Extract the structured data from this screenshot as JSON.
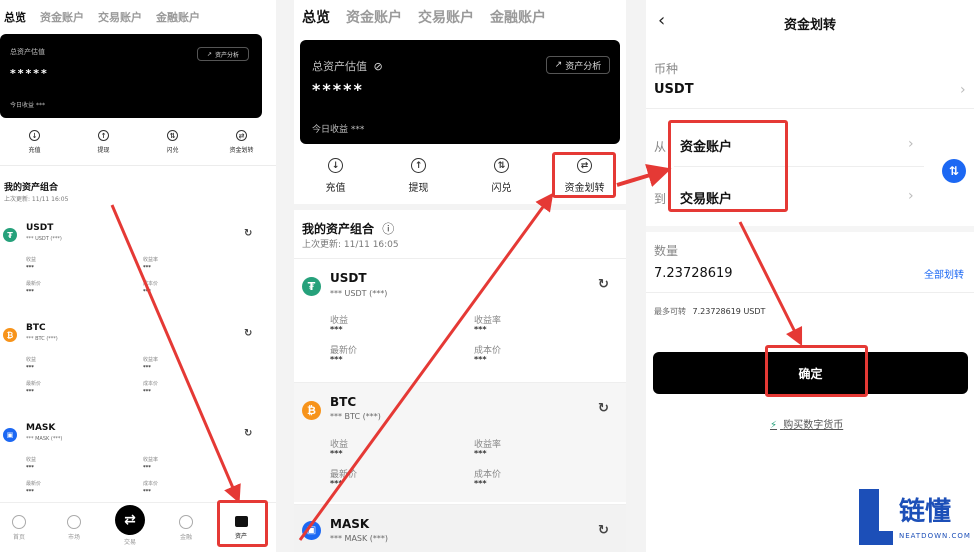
{
  "panel1": {
    "tabs": [
      "总览",
      "资金账户",
      "交易账户",
      "金融账户"
    ],
    "card": {
      "label": "总资产估值",
      "value": "*****",
      "analysis": "资产分析",
      "today": "今日收益",
      "today_value": "***"
    },
    "actions": [
      "充值",
      "提现",
      "闪兑",
      "资金划转"
    ],
    "section_title": "我的资产组合",
    "updated": "上次更新: 11/11 16:05",
    "assets": [
      {
        "symbol": "USDT",
        "sub": "*** USDT (***)",
        "f1": "收益",
        "f2": "收益率",
        "f3": "最新价",
        "f4": "成本价",
        "v": "***"
      },
      {
        "symbol": "BTC",
        "sub": "*** BTC (***)",
        "f1": "收益",
        "f2": "收益率",
        "f3": "最新价",
        "f4": "成本价",
        "v": "***"
      },
      {
        "symbol": "MASK",
        "sub": "*** MASK (***)",
        "f1": "收益",
        "f2": "收益率",
        "f3": "最新价",
        "f4": "成本价",
        "v": "***"
      }
    ],
    "nav": [
      "首页",
      "市场",
      "交易",
      "金融",
      "资产"
    ]
  },
  "panel2": {
    "tabs": [
      "总览",
      "资金账户",
      "交易账户",
      "金融账户"
    ],
    "card": {
      "label": "总资产估值",
      "value": "*****",
      "analysis": "资产分析",
      "today": "今日收益",
      "today_value": "***"
    },
    "actions": [
      "充值",
      "提现",
      "闪兑",
      "资金划转"
    ],
    "section_title": "我的资产组合",
    "updated": "上次更新: 11/11 16:05",
    "assets": [
      {
        "symbol": "USDT",
        "sub": "*** USDT (***)",
        "f1": "收益",
        "f2": "收益率",
        "f3": "最新价",
        "f4": "成本价",
        "v": "***"
      },
      {
        "symbol": "BTC",
        "sub": "*** BTC (***)",
        "f1": "收益",
        "f2": "收益率",
        "f3": "最新价",
        "f4": "成本价",
        "v": "***"
      },
      {
        "symbol": "MASK",
        "sub": "*** MASK (***)"
      }
    ]
  },
  "panel3": {
    "title": "资金划转",
    "currency_label": "币种",
    "currency_value": "USDT",
    "from_label": "从",
    "from_value": "资金账户",
    "to_label": "到",
    "to_value": "交易账户",
    "amount_label": "数量",
    "amount_value": "7.23728619",
    "transfer_all": "全部划转",
    "max_label": "最多可转",
    "max_value": "7.23728619 USDT",
    "confirm": "确定",
    "buy_link": "购买数字货币"
  },
  "watermark": {
    "brand": "链懂",
    "domain": "NEATDOWN.COM"
  },
  "colors": {
    "red": "#e53935",
    "usdt": "#26a17b",
    "btc": "#f7931a",
    "mask": "#1c68f3",
    "swap": "#1c68f3",
    "link": "#1c68f3"
  }
}
